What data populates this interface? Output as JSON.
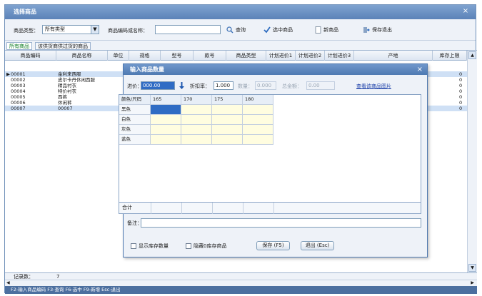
{
  "window": {
    "title": "选择商品"
  },
  "toolbar": {
    "type_label": "商品类型：",
    "type_value": "所有类型",
    "code_label": "商品编码或名称：",
    "code_value": "",
    "query": "查询",
    "select": "选中商品",
    "new": "新商品",
    "save_exit": "保存退出"
  },
  "tabs": [
    "所有商品",
    "该供货商供过货的商品"
  ],
  "grid": {
    "columns": [
      "商品编码",
      "商品名称",
      "单位",
      "规格",
      "型号",
      "款号",
      "商品类型",
      "计划进价1",
      "计划进价2",
      "计划进价3",
      "产地",
      "库存上限"
    ],
    "rows": [
      {
        "code": "00001",
        "name": "金利来西服",
        "stock": "0"
      },
      {
        "code": "00002",
        "name": "皮尔卡丹休闲西服",
        "stock": "0"
      },
      {
        "code": "00003",
        "name": "精品衬衣",
        "stock": "0"
      },
      {
        "code": "00004",
        "name": "特价衬衣",
        "stock": "0"
      },
      {
        "code": "00005",
        "name": "西裤",
        "stock": "0"
      },
      {
        "code": "00006",
        "name": "休闲裤",
        "stock": "0"
      },
      {
        "code": "00007",
        "name": "00007",
        "stock": "0"
      }
    ],
    "footer_label": "记录数：",
    "footer_value": "7"
  },
  "status": "F2-输入商品编码 F3-查询 F6-选中 F9-新增 Esc-退出",
  "dialog": {
    "title": "输入商品数量",
    "price_label": "进价：",
    "price_value": "000.00",
    "discount_label": "折扣率：",
    "discount_value": "1.000",
    "qty_label": "数量：",
    "qty_value": "0.000",
    "amount_label": "总金额：",
    "amount_value": "0.00",
    "view_image": "查看该商品图片",
    "matrix": {
      "corner": "颜色/尺码",
      "sizes": [
        "165",
        "170",
        "175",
        "180"
      ],
      "colors": [
        "黑色",
        "白色",
        "灰色",
        "蓝色"
      ],
      "total": "合计"
    },
    "remark_label": "备注：",
    "show_stock": "显示库存数量",
    "hide_zero": "隐藏0库存商品",
    "save": "保存 (F5)",
    "exit": "退出 (Esc)"
  }
}
